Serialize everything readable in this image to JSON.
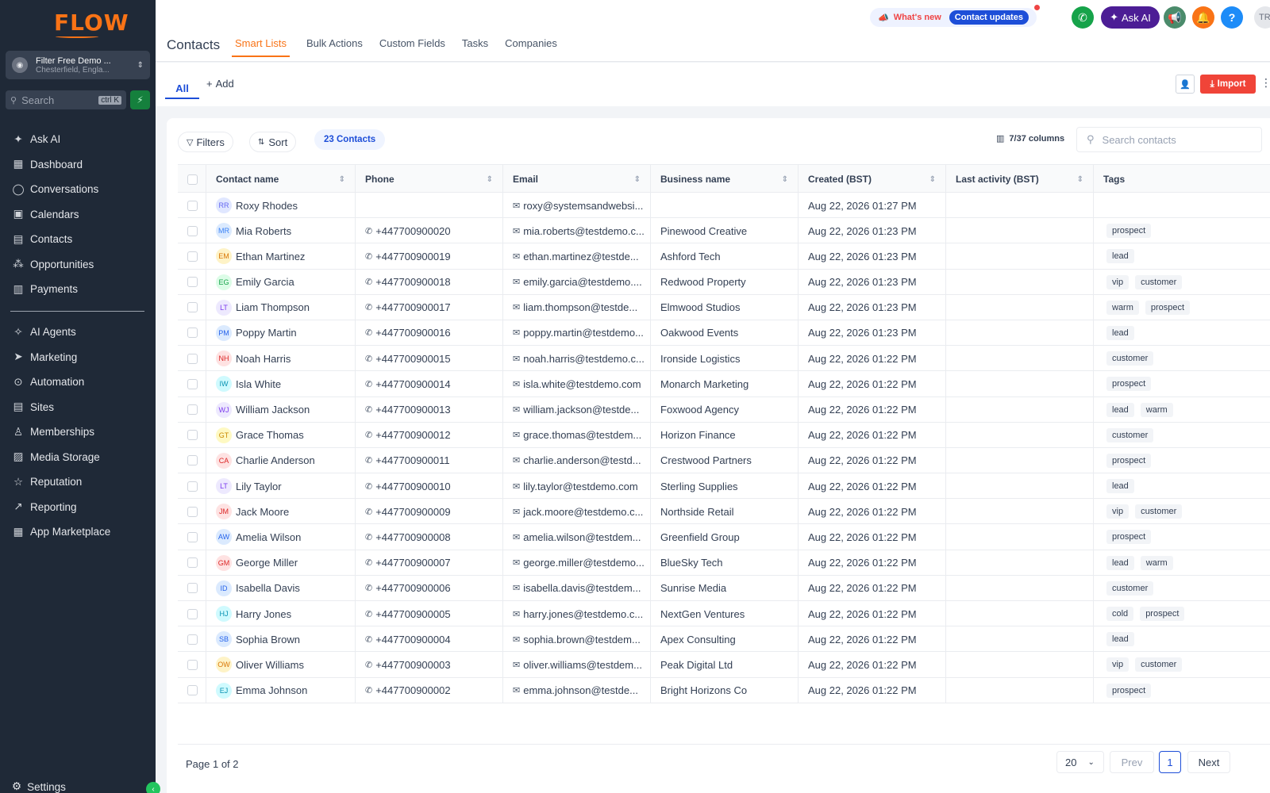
{
  "brand": {
    "logo": "FLOW",
    "accent": "#f97316"
  },
  "account": {
    "name": "Filter Free Demo ...",
    "location": "Chesterfield, Engla..."
  },
  "sidebar_search": {
    "placeholder": "Search",
    "shortcut": "ctrl K"
  },
  "nav_primary": [
    {
      "label": "Ask AI",
      "icon": "sparkle-icon"
    },
    {
      "label": "Dashboard",
      "icon": "grid-icon"
    },
    {
      "label": "Conversations",
      "icon": "chat-icon"
    },
    {
      "label": "Calendars",
      "icon": "calendar-icon"
    },
    {
      "label": "Contacts",
      "icon": "contacts-icon"
    },
    {
      "label": "Opportunities",
      "icon": "pipeline-icon"
    },
    {
      "label": "Payments",
      "icon": "receipt-icon"
    }
  ],
  "nav_secondary": [
    {
      "label": "AI Agents",
      "icon": "agent-icon"
    },
    {
      "label": "Marketing",
      "icon": "send-icon"
    },
    {
      "label": "Automation",
      "icon": "automation-icon"
    },
    {
      "label": "Sites",
      "icon": "sites-icon"
    },
    {
      "label": "Memberships",
      "icon": "memberships-icon"
    },
    {
      "label": "Media Storage",
      "icon": "image-icon"
    },
    {
      "label": "Reputation",
      "icon": "star-icon"
    },
    {
      "label": "Reporting",
      "icon": "trend-icon"
    },
    {
      "label": "App Marketplace",
      "icon": "apps-icon"
    }
  ],
  "settings_label": "Settings",
  "header": {
    "title": "Contacts",
    "tabs": [
      "Smart Lists",
      "Bulk Actions",
      "Custom Fields",
      "Tasks",
      "Companies"
    ],
    "active_tab": "Smart Lists",
    "whats_new": "What's new",
    "contact_updates": "Contact updates",
    "ask_ai": "Ask AI",
    "user_initials": "TR"
  },
  "subbar": {
    "all": "All",
    "add": "Add",
    "import": "Import"
  },
  "toolbar": {
    "filters": "Filters",
    "sort": "Sort",
    "count": "23 Contacts",
    "columns": "7/37 columns",
    "search_placeholder": "Search contacts"
  },
  "columns": [
    "Contact name",
    "Phone",
    "Email",
    "Business name",
    "Created (BST)",
    "Last activity (BST)",
    "Tags"
  ],
  "rows": [
    {
      "initials": "RR",
      "name": "Roxy Rhodes",
      "phone": "",
      "email": "roxy@systemsandwebsi...",
      "business": "",
      "created": "Aug 22, 2026 01:27 PM",
      "last": "",
      "tags": [],
      "color": "#e0e7ff",
      "tcolor": "#6366f1"
    },
    {
      "initials": "MR",
      "name": "Mia Roberts",
      "phone": "+447700900020",
      "email": "mia.roberts@testdemo.c...",
      "business": "Pinewood Creative",
      "created": "Aug 22, 2026 01:23 PM",
      "last": "",
      "tags": [
        "prospect"
      ],
      "color": "#dbeafe",
      "tcolor": "#3b82f6"
    },
    {
      "initials": "EM",
      "name": "Ethan Martinez",
      "phone": "+447700900019",
      "email": "ethan.martinez@testde...",
      "business": "Ashford Tech",
      "created": "Aug 22, 2026 01:23 PM",
      "last": "",
      "tags": [
        "lead"
      ],
      "color": "#fef3c7",
      "tcolor": "#d97706"
    },
    {
      "initials": "EG",
      "name": "Emily Garcia",
      "phone": "+447700900018",
      "email": "emily.garcia@testdemo....",
      "business": "Redwood Property",
      "created": "Aug 22, 2026 01:23 PM",
      "last": "",
      "tags": [
        "vip",
        "customer"
      ],
      "color": "#dcfce7",
      "tcolor": "#16a34a"
    },
    {
      "initials": "LT",
      "name": "Liam Thompson",
      "phone": "+447700900017",
      "email": "liam.thompson@testde...",
      "business": "Elmwood Studios",
      "created": "Aug 22, 2026 01:23 PM",
      "last": "",
      "tags": [
        "warm",
        "prospect"
      ],
      "color": "#ede9fe",
      "tcolor": "#7c3aed"
    },
    {
      "initials": "PM",
      "name": "Poppy Martin",
      "phone": "+447700900016",
      "email": "poppy.martin@testdemo...",
      "business": "Oakwood Events",
      "created": "Aug 22, 2026 01:23 PM",
      "last": "",
      "tags": [
        "lead"
      ],
      "color": "#dbeafe",
      "tcolor": "#2563eb"
    },
    {
      "initials": "NH",
      "name": "Noah Harris",
      "phone": "+447700900015",
      "email": "noah.harris@testdemo.c...",
      "business": "Ironside Logistics",
      "created": "Aug 22, 2026 01:22 PM",
      "last": "",
      "tags": [
        "customer"
      ],
      "color": "#fee2e2",
      "tcolor": "#dc2626"
    },
    {
      "initials": "IW",
      "name": "Isla White",
      "phone": "+447700900014",
      "email": "isla.white@testdemo.com",
      "business": "Monarch Marketing",
      "created": "Aug 22, 2026 01:22 PM",
      "last": "",
      "tags": [
        "prospect"
      ],
      "color": "#cffafe",
      "tcolor": "#0891b2"
    },
    {
      "initials": "WJ",
      "name": "William Jackson",
      "phone": "+447700900013",
      "email": "william.jackson@testde...",
      "business": "Foxwood Agency",
      "created": "Aug 22, 2026 01:22 PM",
      "last": "",
      "tags": [
        "lead",
        "warm"
      ],
      "color": "#ede9fe",
      "tcolor": "#7c3aed"
    },
    {
      "initials": "GT",
      "name": "Grace Thomas",
      "phone": "+447700900012",
      "email": "grace.thomas@testdem...",
      "business": "Horizon Finance",
      "created": "Aug 22, 2026 01:22 PM",
      "last": "",
      "tags": [
        "customer"
      ],
      "color": "#fef9c3",
      "tcolor": "#ca8a04"
    },
    {
      "initials": "CA",
      "name": "Charlie Anderson",
      "phone": "+447700900011",
      "email": "charlie.anderson@testd...",
      "business": "Crestwood Partners",
      "created": "Aug 22, 2026 01:22 PM",
      "last": "",
      "tags": [
        "prospect"
      ],
      "color": "#fee2e2",
      "tcolor": "#dc2626"
    },
    {
      "initials": "LT",
      "name": "Lily Taylor",
      "phone": "+447700900010",
      "email": "lily.taylor@testdemo.com",
      "business": "Sterling Supplies",
      "created": "Aug 22, 2026 01:22 PM",
      "last": "",
      "tags": [
        "lead"
      ],
      "color": "#ede9fe",
      "tcolor": "#7c3aed"
    },
    {
      "initials": "JM",
      "name": "Jack Moore",
      "phone": "+447700900009",
      "email": "jack.moore@testdemo.c...",
      "business": "Northside Retail",
      "created": "Aug 22, 2026 01:22 PM",
      "last": "",
      "tags": [
        "vip",
        "customer"
      ],
      "color": "#fee2e2",
      "tcolor": "#dc2626"
    },
    {
      "initials": "AW",
      "name": "Amelia Wilson",
      "phone": "+447700900008",
      "email": "amelia.wilson@testdem...",
      "business": "Greenfield Group",
      "created": "Aug 22, 2026 01:22 PM",
      "last": "",
      "tags": [
        "prospect"
      ],
      "color": "#dbeafe",
      "tcolor": "#2563eb"
    },
    {
      "initials": "GM",
      "name": "George Miller",
      "phone": "+447700900007",
      "email": "george.miller@testdemo...",
      "business": "BlueSky Tech",
      "created": "Aug 22, 2026 01:22 PM",
      "last": "",
      "tags": [
        "lead",
        "warm"
      ],
      "color": "#fee2e2",
      "tcolor": "#dc2626"
    },
    {
      "initials": "ID",
      "name": "Isabella Davis",
      "phone": "+447700900006",
      "email": "isabella.davis@testdem...",
      "business": "Sunrise Media",
      "created": "Aug 22, 2026 01:22 PM",
      "last": "",
      "tags": [
        "customer"
      ],
      "color": "#dbeafe",
      "tcolor": "#2563eb"
    },
    {
      "initials": "HJ",
      "name": "Harry Jones",
      "phone": "+447700900005",
      "email": "harry.jones@testdemo.c...",
      "business": "NextGen Ventures",
      "created": "Aug 22, 2026 01:22 PM",
      "last": "",
      "tags": [
        "cold",
        "prospect"
      ],
      "color": "#cffafe",
      "tcolor": "#0891b2"
    },
    {
      "initials": "SB",
      "name": "Sophia Brown",
      "phone": "+447700900004",
      "email": "sophia.brown@testdem...",
      "business": "Apex Consulting",
      "created": "Aug 22, 2026 01:22 PM",
      "last": "",
      "tags": [
        "lead"
      ],
      "color": "#dbeafe",
      "tcolor": "#2563eb"
    },
    {
      "initials": "OW",
      "name": "Oliver Williams",
      "phone": "+447700900003",
      "email": "oliver.williams@testdem...",
      "business": "Peak Digital Ltd",
      "created": "Aug 22, 2026 01:22 PM",
      "last": "",
      "tags": [
        "vip",
        "customer"
      ],
      "color": "#fef3c7",
      "tcolor": "#d97706"
    },
    {
      "initials": "EJ",
      "name": "Emma Johnson",
      "phone": "+447700900002",
      "email": "emma.johnson@testde...",
      "business": "Bright Horizons Co",
      "created": "Aug 22, 2026 01:22 PM",
      "last": "",
      "tags": [
        "prospect"
      ],
      "color": "#cffafe",
      "tcolor": "#0891b2"
    }
  ],
  "pagination": {
    "text": "Page 1 of 2",
    "per_page": "20",
    "prev": "Prev",
    "current": "1",
    "next": "Next"
  }
}
